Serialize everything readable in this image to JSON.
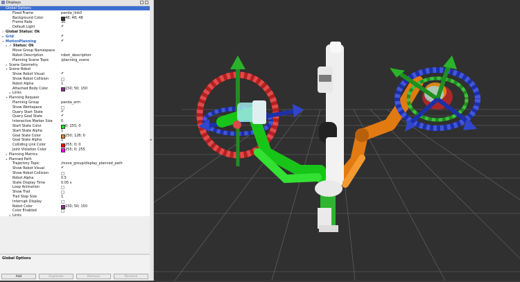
{
  "panel": {
    "title": "Displays",
    "description_title": "Global Options",
    "buttons": {
      "add": "Add",
      "duplicate": "Duplicate",
      "remove": "Remove",
      "rename": "Rename"
    }
  },
  "tree": [
    {
      "indent": 0,
      "exp": "▾",
      "label": "Global Options",
      "kind": "selected"
    },
    {
      "indent": 2,
      "label": "Fixed Frame",
      "value": "panda_link0"
    },
    {
      "indent": 2,
      "label": "Background Color",
      "swatch": "#303030",
      "value": "48; 48; 48"
    },
    {
      "indent": 2,
      "label": "Frame Rate",
      "value": "30"
    },
    {
      "indent": 2,
      "label": "Default Light",
      "check": true
    },
    {
      "indent": 0,
      "exp": "✓",
      "label": "Global Status: Ok",
      "kind": "ok"
    },
    {
      "indent": 0,
      "exp": "▸",
      "label": "Grid",
      "kind": "cat",
      "check": true
    },
    {
      "indent": 0,
      "exp": "▾",
      "label": "MotionPlanning",
      "kind": "cat",
      "check": true
    },
    {
      "indent": 1,
      "exp": "▸",
      "label": "✓  Status: Ok",
      "kind": "ok"
    },
    {
      "indent": 2,
      "label": "Move Group Namespace",
      "value": ""
    },
    {
      "indent": 2,
      "label": "Robot Description",
      "value": "robot_description"
    },
    {
      "indent": 2,
      "label": "Planning Scene Topic",
      "value": "/planning_scene"
    },
    {
      "indent": 1,
      "exp": "▸",
      "label": "Scene Geometry"
    },
    {
      "indent": 1,
      "exp": "▾",
      "label": "Scene Robot"
    },
    {
      "indent": 2,
      "label": "Show Robot Visual",
      "check": true
    },
    {
      "indent": 2,
      "label": "Show Robot Collision",
      "check": false
    },
    {
      "indent": 2,
      "label": "Robot Alpha",
      "value": "1"
    },
    {
      "indent": 2,
      "label": "Attached Body Color",
      "swatch": "#962896",
      "value": "150; 50; 150"
    },
    {
      "indent": 2,
      "exp": "▸",
      "label": "Links"
    },
    {
      "indent": 1,
      "exp": "▾",
      "label": "Planning Request"
    },
    {
      "indent": 2,
      "label": "Planning Group",
      "value": "panda_arm"
    },
    {
      "indent": 2,
      "label": "Show Workspace",
      "check": false
    },
    {
      "indent": 2,
      "label": "Query Start State",
      "check": true
    },
    {
      "indent": 2,
      "label": "Query Goal State",
      "check": true
    },
    {
      "indent": 2,
      "label": "Interactive Marker Size",
      "value": "0"
    },
    {
      "indent": 2,
      "label": "Start State Color",
      "swatch": "#00ff00",
      "value": "0; 255; 0"
    },
    {
      "indent": 2,
      "label": "Start State Alpha",
      "value": "1"
    },
    {
      "indent": 2,
      "label": "Goal State Color",
      "swatch": "#fa8000",
      "value": "250; 128; 0"
    },
    {
      "indent": 2,
      "label": "Goal State Alpha",
      "value": "1"
    },
    {
      "indent": 2,
      "label": "Colliding Link Color",
      "swatch": "#ff0000",
      "value": "255; 0; 0"
    },
    {
      "indent": 2,
      "label": "Joint Violation Color",
      "swatch": "#ff00ff",
      "value": "255; 0; 255"
    },
    {
      "indent": 1,
      "exp": "▸",
      "label": "Planning Metrics"
    },
    {
      "indent": 1,
      "exp": "▾",
      "label": "Planned Path"
    },
    {
      "indent": 2,
      "label": "Trajectory Topic",
      "value": "/move_group/display_planned_path"
    },
    {
      "indent": 2,
      "label": "Show Robot Visual",
      "check": true
    },
    {
      "indent": 2,
      "label": "Show Robot Collision",
      "check": false
    },
    {
      "indent": 2,
      "label": "Robot Alpha",
      "value": "0.5"
    },
    {
      "indent": 2,
      "label": "State Display Time",
      "value": "0.05 s"
    },
    {
      "indent": 2,
      "label": "Loop Animation",
      "check": false
    },
    {
      "indent": 2,
      "label": "Show Trail",
      "check": false
    },
    {
      "indent": 2,
      "label": "Trail Step Size",
      "value": "1"
    },
    {
      "indent": 2,
      "label": "Interrupt Display",
      "check": false
    },
    {
      "indent": 2,
      "label": "Robot Color",
      "swatch": "#962896",
      "value": "150; 50; 150"
    },
    {
      "indent": 2,
      "label": "Color Enabled",
      "check": false
    },
    {
      "indent": 2,
      "exp": "▸",
      "label": "Links"
    }
  ]
}
